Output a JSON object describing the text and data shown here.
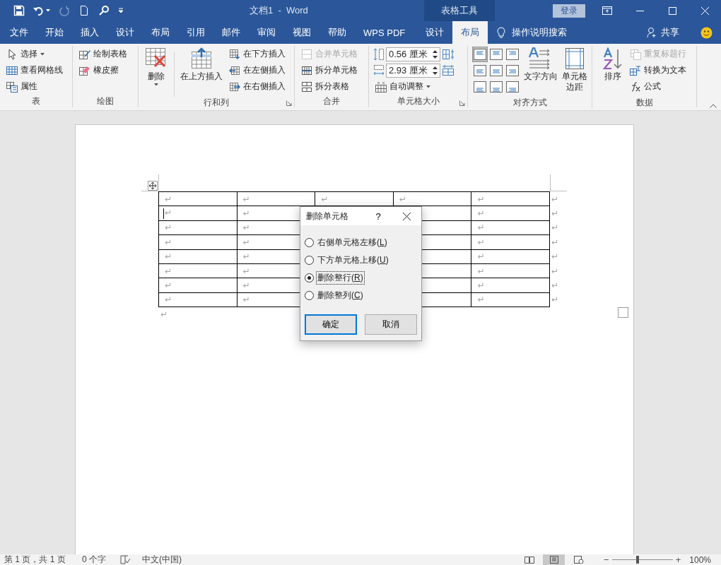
{
  "title_bar": {
    "title": "文档1  -  Word",
    "context_title": "表格工具",
    "sign_in": "登录"
  },
  "tabs": [
    {
      "label": "文件",
      "kind": "main",
      "selected": false
    },
    {
      "label": "开始",
      "kind": "main",
      "selected": false
    },
    {
      "label": "插入",
      "kind": "main",
      "selected": false
    },
    {
      "label": "设计",
      "kind": "main",
      "selected": false
    },
    {
      "label": "布局",
      "kind": "main",
      "selected": false
    },
    {
      "label": "引用",
      "kind": "main",
      "selected": false
    },
    {
      "label": "邮件",
      "kind": "main",
      "selected": false
    },
    {
      "label": "审阅",
      "kind": "main",
      "selected": false
    },
    {
      "label": "视图",
      "kind": "main",
      "selected": false
    },
    {
      "label": "帮助",
      "kind": "main",
      "selected": false
    },
    {
      "label": "WPS PDF",
      "kind": "main",
      "selected": false
    },
    {
      "label": "设计",
      "kind": "context",
      "selected": false
    },
    {
      "label": "布局",
      "kind": "context",
      "selected": true
    }
  ],
  "tell_me": "操作说明搜索",
  "share": "共享",
  "ribbon": {
    "groups": [
      {
        "kind": "table",
        "label": "表",
        "small": [
          {
            "label": "选择",
            "disabled": false
          },
          {
            "label": "查看网格线",
            "disabled": false
          },
          {
            "label": "属性",
            "disabled": false
          }
        ]
      },
      {
        "kind": "draw",
        "label": "绘图",
        "small": [
          {
            "label": "绘制表格",
            "disabled": false
          },
          {
            "label": "橡皮擦",
            "disabled": false
          }
        ]
      },
      {
        "kind": "rows",
        "label": "行和列",
        "large": [
          {
            "label": "删除"
          },
          {
            "label": "在上方插入"
          }
        ],
        "small": [
          {
            "label": "在下方插入",
            "disabled": false
          },
          {
            "label": "在左侧插入",
            "disabled": false
          },
          {
            "label": "在右侧插入",
            "disabled": false
          }
        ]
      },
      {
        "kind": "merge",
        "label": "合并",
        "small": [
          {
            "label": "合并单元格",
            "disabled": true
          },
          {
            "label": "拆分单元格",
            "disabled": false
          },
          {
            "label": "拆分表格",
            "disabled": false
          }
        ]
      },
      {
        "kind": "size",
        "label": "单元格大小",
        "fields": [
          {
            "value": "0.56 厘米"
          },
          {
            "value": "2.93 厘米"
          }
        ],
        "small": [
          {
            "label": "自动调整",
            "disabled": false
          }
        ]
      },
      {
        "kind": "align",
        "label": "对齐方式",
        "cells": [
          {
            "selected": true
          },
          {
            "selected": false
          },
          {
            "selected": false
          },
          {
            "selected": false
          },
          {
            "selected": false
          },
          {
            "selected": false
          },
          {
            "selected": false
          },
          {
            "selected": false
          },
          {
            "selected": false
          }
        ],
        "large": [
          {
            "label": "文字方向"
          },
          {
            "label": "单元格边距"
          }
        ]
      },
      {
        "kind": "data",
        "label": "数据",
        "large": [
          {
            "label": "排序"
          }
        ],
        "small": [
          {
            "label": "重复标题行",
            "disabled": true
          },
          {
            "label": "转换为文本",
            "disabled": false
          },
          {
            "label": "公式",
            "disabled": false
          }
        ]
      }
    ]
  },
  "table": {
    "rows": [
      {
        "cursor": false,
        "cells": [
          "↵",
          "↵",
          "↵",
          "↵",
          "↵"
        ],
        "end": "↵"
      },
      {
        "cursor": true,
        "cells": [
          "↵",
          "↵",
          null,
          null,
          "↵"
        ],
        "end": "↵"
      },
      {
        "cursor": false,
        "cells": [
          "↵",
          "↵",
          null,
          null,
          "↵"
        ],
        "end": "↵"
      },
      {
        "cursor": false,
        "cells": [
          "↵",
          "↵",
          null,
          null,
          "↵"
        ],
        "end": "↵"
      },
      {
        "cursor": false,
        "cells": [
          "↵",
          "↵",
          null,
          null,
          "↵"
        ],
        "end": "↵"
      },
      {
        "cursor": false,
        "cells": [
          "↵",
          "↵",
          null,
          null,
          "↵"
        ],
        "end": "↵"
      },
      {
        "cursor": false,
        "cells": [
          "↵",
          "↵",
          null,
          null,
          "↵"
        ],
        "end": "↵"
      },
      {
        "cursor": false,
        "cells": [
          "↵",
          "↵",
          null,
          null,
          "↵"
        ],
        "end": "↵"
      }
    ],
    "after": "↵"
  },
  "dialog": {
    "title": "删除单元格",
    "help": "?",
    "options": [
      {
        "label": "右侧单元格左移(L)",
        "selected": false
      },
      {
        "label": "下方单元格上移(U)",
        "selected": false
      },
      {
        "label": "删除整行(R)",
        "selected": true
      },
      {
        "label": "删除整列(C)",
        "selected": false
      }
    ],
    "buttons": [
      {
        "label": "确定",
        "default": true
      },
      {
        "label": "取消",
        "default": false
      }
    ]
  },
  "status_bar": {
    "page": "第 1 页，共 1 页",
    "words": "0 个字",
    "language": "中文(中国)",
    "views": [
      {
        "kind": "read",
        "selected": false
      },
      {
        "kind": "print",
        "selected": true
      },
      {
        "kind": "web",
        "selected": false
      }
    ],
    "zoom": {
      "minus": "−",
      "plus": "+",
      "level": 0.4,
      "reading": "100%"
    }
  }
}
